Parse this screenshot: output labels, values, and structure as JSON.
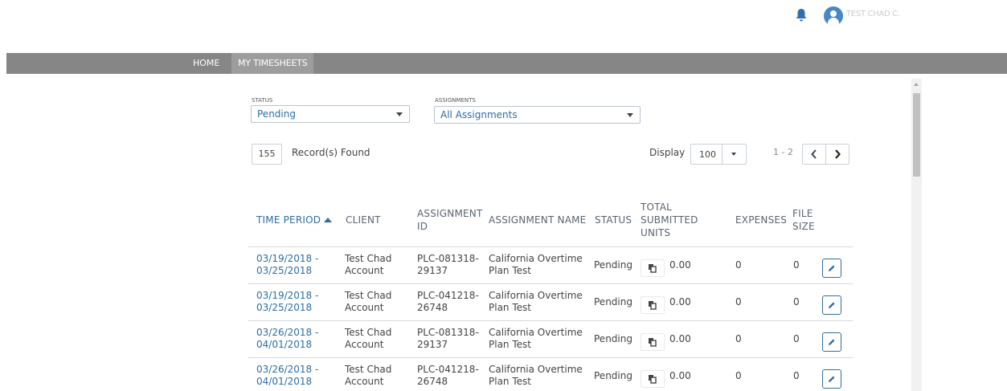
{
  "header": {
    "user_name": "TEST CHAD C.",
    "icons": {
      "notifications": "bell-icon",
      "avatar": "user-avatar-icon"
    }
  },
  "nav": {
    "items": [
      {
        "label": "HOME",
        "active": false
      },
      {
        "label": "MY TIMESHEETS",
        "active": true
      }
    ]
  },
  "filters": {
    "status": {
      "label": "STATUS",
      "value": "Pending"
    },
    "assignments": {
      "label": "ASSIGNMENTS",
      "value": "All Assignments"
    }
  },
  "results": {
    "count": "155",
    "label": "Record(s) Found",
    "display_label": "Display",
    "page_size": "100",
    "range": "1 - 2"
  },
  "table": {
    "columns": {
      "time_period": "TIME PERIOD",
      "client": "CLIENT",
      "assignment_id": "ASSIGNMENT ID",
      "assignment_name": "ASSIGNMENT NAME",
      "status": "STATUS",
      "total_submitted_units": "TOTAL SUBMITTED UNITS",
      "expenses": "EXPENSES",
      "file_size": "FILE SIZE"
    },
    "sort": {
      "column": "time_period",
      "direction": "asc"
    },
    "rows": [
      {
        "period_start": "03/19/2018 -",
        "period_end": "03/25/2018",
        "client_line1": "Test Chad",
        "client_line2": "Account",
        "id_line1": "PLC-081318-",
        "id_line2": "29137",
        "name_line1": "California Overtime",
        "name_line2": "Plan Test",
        "status": "Pending",
        "units": "0.00",
        "expenses": "0",
        "file_size": "0"
      },
      {
        "period_start": "03/19/2018 -",
        "period_end": "03/25/2018",
        "client_line1": "Test Chad",
        "client_line2": "Account",
        "id_line1": "PLC-041218-",
        "id_line2": "26748",
        "name_line1": "California Overtime",
        "name_line2": "Plan Test",
        "status": "Pending",
        "units": "0.00",
        "expenses": "0",
        "file_size": "0"
      },
      {
        "period_start": "03/26/2018 -",
        "period_end": "04/01/2018",
        "client_line1": "Test Chad",
        "client_line2": "Account",
        "id_line1": "PLC-081318-",
        "id_line2": "29137",
        "name_line1": "California Overtime",
        "name_line2": "Plan Test",
        "status": "Pending",
        "units": "0.00",
        "expenses": "0",
        "file_size": "0"
      },
      {
        "period_start": "03/26/2018 -",
        "period_end": "04/01/2018",
        "client_line1": "Test Chad",
        "client_line2": "Account",
        "id_line1": "PLC-041218-",
        "id_line2": "26748",
        "name_line1": "California Overtime",
        "name_line2": "Plan Test",
        "status": "Pending",
        "units": "0.00",
        "expenses": "0",
        "file_size": "0"
      }
    ]
  },
  "colors": {
    "nav_bg": "#868686",
    "nav_active_bg": "#9d9d9d",
    "link": "#2e6da4",
    "accent": "#4a86c5"
  }
}
